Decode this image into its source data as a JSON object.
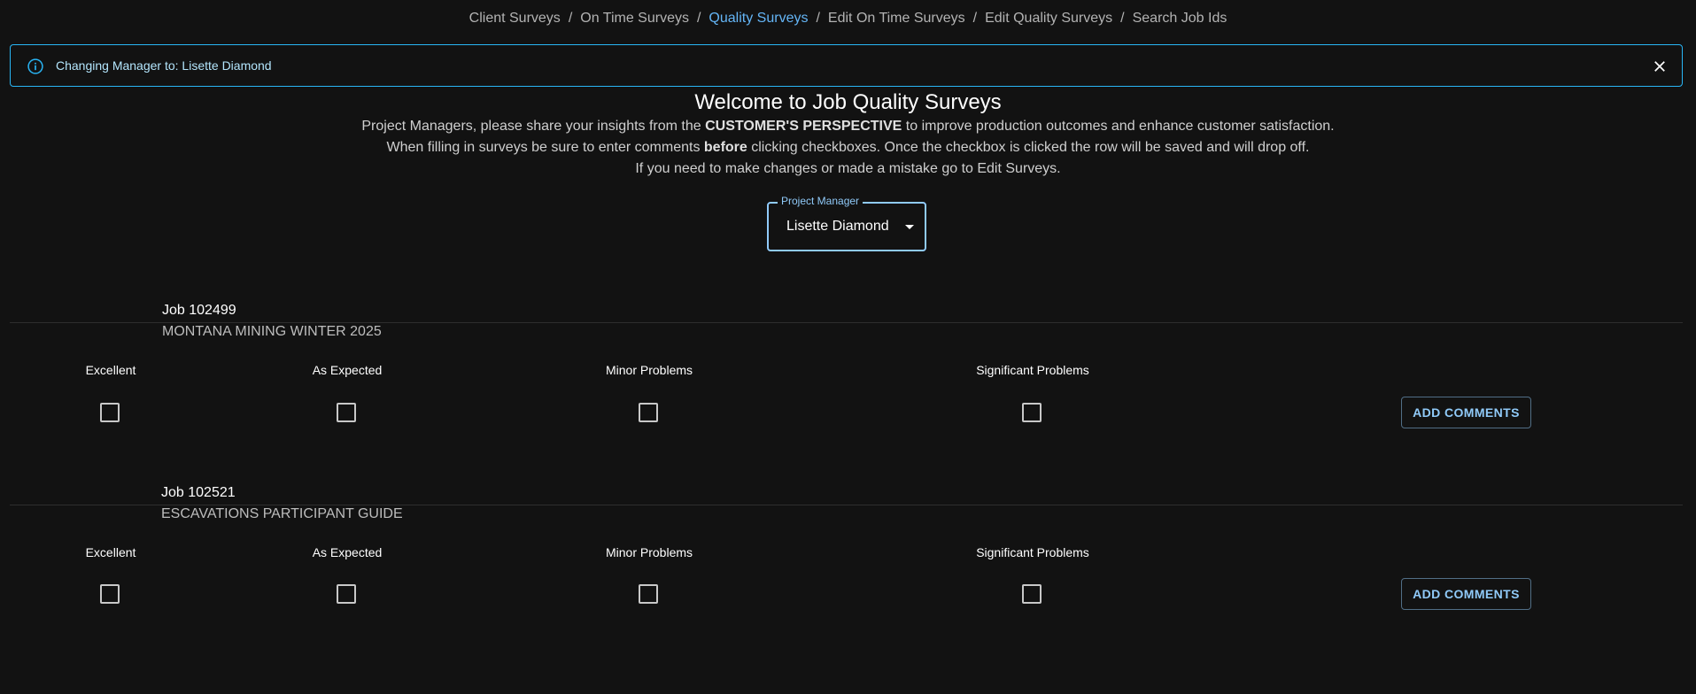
{
  "breadcrumbs": [
    {
      "label": "Client Surveys",
      "active": false
    },
    {
      "label": "On Time Surveys",
      "active": false
    },
    {
      "label": "Quality Surveys",
      "active": true
    },
    {
      "label": "Edit On Time Surveys",
      "active": false
    },
    {
      "label": "Edit Quality Surveys",
      "active": false
    },
    {
      "label": "Search Job Ids",
      "active": false
    }
  ],
  "alert": {
    "text": "Changing Manager to: Lisette Diamond",
    "icon": "info-icon",
    "close_icon": "close-icon",
    "color": "#29b6f6"
  },
  "welcome": {
    "title": "Welcome to Job Quality Surveys",
    "line1_pre": "Project Managers, please share your insights from the ",
    "line1_bold": "CUSTOMER'S PERSPECTIVE",
    "line1_post": " to improve production outcomes and enhance customer satisfaction.",
    "line2_pre": "When filling in surveys be sure to enter comments ",
    "line2_bold": "before",
    "line2_post": " clicking checkboxes. Once the checkbox is clicked the row will be saved and will drop off.",
    "line3": "If you need to make changes or made a mistake go to Edit Surveys."
  },
  "project_manager": {
    "label": "Project Manager",
    "value": "Lisette Diamond",
    "accent": "#90caf9"
  },
  "jobs": [
    {
      "id": "Job 102499",
      "name": "MONTANA MINING WINTER 2025",
      "options": [
        "Excellent",
        "As Expected",
        "Minor Problems",
        "Significant Problems"
      ],
      "button": "ADD COMMENTS"
    },
    {
      "id": "Job 102521",
      "name": "ESCAVATIONS PARTICIPANT GUIDE",
      "options": [
        "Excellent",
        "As Expected",
        "Minor Problems",
        "Significant Problems"
      ],
      "button": "ADD COMMENTS"
    }
  ]
}
